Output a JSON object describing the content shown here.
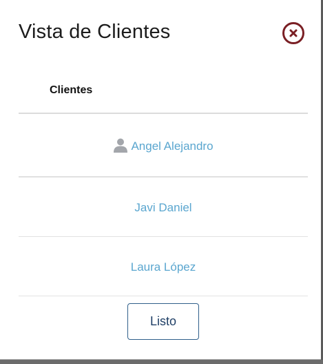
{
  "modal": {
    "title": "Vista de Clientes",
    "close_icon": "close-circle-icon",
    "accent_color": "#7a1f24"
  },
  "table": {
    "header": "Clientes",
    "rows": [
      {
        "name": "Angel Alejandro",
        "icon": "person-icon"
      },
      {
        "name": "Javi Daniel"
      },
      {
        "name": "Laura López"
      }
    ],
    "link_color": "#5aa6cf"
  },
  "footer": {
    "done_label": "Listo"
  }
}
